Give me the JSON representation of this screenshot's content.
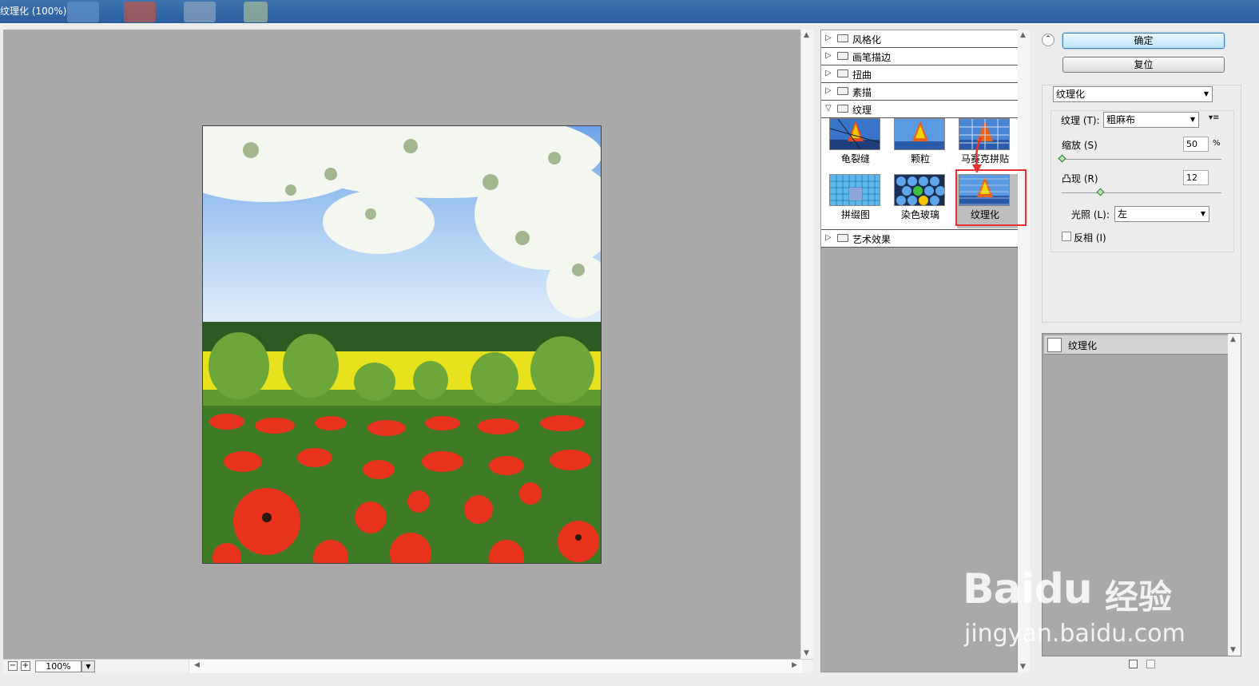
{
  "window": {
    "title": "纹理化 (100%)"
  },
  "preview": {
    "zoom": "100%",
    "zoom_out": "−",
    "zoom_in": "+"
  },
  "gallery": {
    "categories": [
      {
        "label": "风格化",
        "expanded": false
      },
      {
        "label": "画笔描边",
        "expanded": false
      },
      {
        "label": "扭曲",
        "expanded": false
      },
      {
        "label": "素描",
        "expanded": false
      },
      {
        "label": "纹理",
        "expanded": true
      },
      {
        "label": "艺术效果",
        "expanded": false
      }
    ],
    "texture_filters": [
      "龟裂缝",
      "颗粒",
      "马赛克拼贴",
      "拼缀图",
      "染色玻璃",
      "纹理化"
    ],
    "selected_filter": "纹理化"
  },
  "buttons": {
    "ok": "确定",
    "reset": "复位"
  },
  "settings": {
    "filter_select": "纹理化",
    "texture_label": "纹理 (T):",
    "texture_value": "粗麻布",
    "scale_label": "缩放 (S)",
    "scale_value": "50",
    "scale_unit": "%",
    "scale_fraction": 0.0,
    "relief_label": "凸现 (R)",
    "relief_value": "12",
    "relief_fraction": 0.24,
    "light_label": "光照 (L):",
    "light_value": "左",
    "invert_label": "反相 (I)",
    "invert_checked": false
  },
  "layers": {
    "items": [
      "纹理化"
    ]
  },
  "watermark": {
    "brand": "Bai",
    "brand2": "du",
    "cn": "经验",
    "url": "jingyan.baidu.com"
  }
}
